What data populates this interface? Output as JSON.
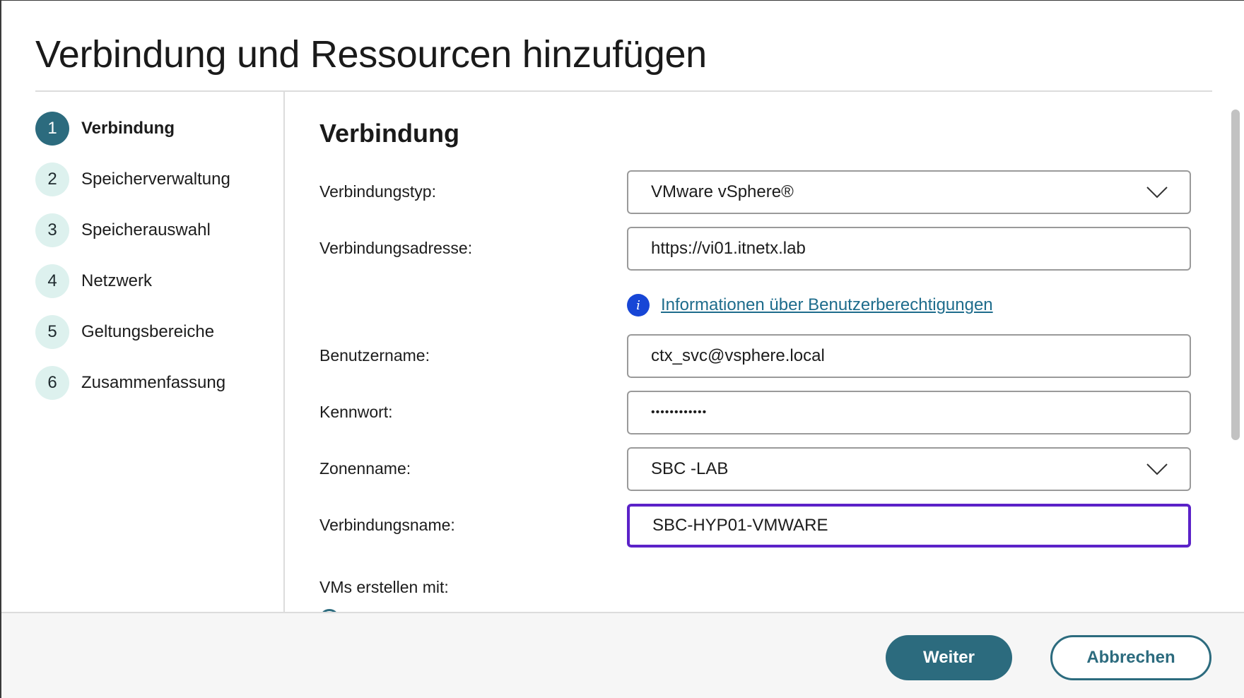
{
  "dialog": {
    "title": "Verbindung und Ressourcen hinzufügen"
  },
  "steps": [
    {
      "number": "1",
      "label": "Verbindung",
      "active": true
    },
    {
      "number": "2",
      "label": "Speicherverwaltung",
      "active": false
    },
    {
      "number": "3",
      "label": "Speicherauswahl",
      "active": false
    },
    {
      "number": "4",
      "label": "Netzwerk",
      "active": false
    },
    {
      "number": "5",
      "label": "Geltungsbereiche",
      "active": false
    },
    {
      "number": "6",
      "label": "Zusammenfassung",
      "active": false
    }
  ],
  "section": {
    "title": "Verbindung"
  },
  "form": {
    "connection_type": {
      "label": "Verbindungstyp:",
      "value": "VMware vSphere®"
    },
    "connection_address": {
      "label": "Verbindungsadresse:",
      "value": "https://vi01.itnetx.lab"
    },
    "info_link": {
      "text": "Informationen über Benutzerberechtigungen"
    },
    "username": {
      "label": "Benutzername:",
      "value": "ctx_svc@vsphere.local"
    },
    "password": {
      "label": "Kennwort:",
      "value": "••••••••••••"
    },
    "zone_name": {
      "label": "Zonenname:",
      "value": "SBC -LAB"
    },
    "connection_name": {
      "label": "Verbindungsname:",
      "value": "SBC-HYP01-VMWARE"
    },
    "create_vms_with": {
      "label": "VMs erstellen mit:"
    }
  },
  "footer": {
    "next_label": "Weiter",
    "cancel_label": "Abbrechen"
  },
  "colors": {
    "accent": "#2c6b7e",
    "focus": "#5b22c8",
    "info": "#1746d6",
    "link": "#1e6c8c"
  }
}
